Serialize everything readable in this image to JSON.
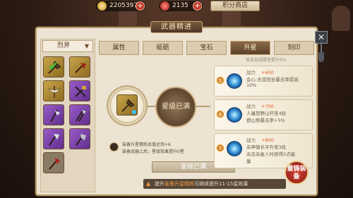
{
  "currency": {
    "gold": {
      "value": "2205397",
      "icon": "gold-ingot-icon"
    },
    "gems": {
      "value": "2135",
      "icon": "red-gem-icon"
    },
    "shop_label": "积分商店"
  },
  "panel": {
    "title": "武器精进",
    "filter_label": "烈斧",
    "tabs": [
      "属性",
      "砥砺",
      "宝石",
      "升星",
      "刻印"
    ],
    "active_tab": "升星"
  },
  "center": {
    "star_status": "星级已满",
    "desc_lines": [
      "装备升星精练总值达到+6",
      "装备武器上后，星级效果提升0星"
    ],
    "maxed_button": "星级已满"
  },
  "list": {
    "top_partial": "攻击加成属性提升5%",
    "items": [
      {
        "num": "5",
        "label": "战力",
        "value": "+600",
        "line1": "会心:无双回合暴击率提高",
        "line2": "10%",
        "line3": ""
      },
      {
        "num": "6",
        "label": "战力",
        "value": "+700",
        "line1": "人屠怒野山开至4段",
        "line2": "攒山势暴击率+5%",
        "line3": ""
      },
      {
        "num": "7",
        "label": "战力",
        "value": "+800",
        "line1": "杀神镇长平升至3段",
        "line2": "杀击杀敌人时获得2点能",
        "line3": "量"
      }
    ]
  },
  "forge_button": "重铸装备",
  "hint": {
    "prefix": "提升",
    "highlight": "装备升星精练",
    "suffix": "可继续提升11-15星效果"
  },
  "grid": {
    "slots": [
      {
        "rarity": "gold",
        "icon": "axe-weapon-icon",
        "selected": true
      },
      {
        "rarity": "gold",
        "icon": "winged-axe-icon",
        "selected": false
      },
      {
        "rarity": "gold",
        "icon": "butterfly-axe-icon",
        "selected": false
      },
      {
        "rarity": "purple",
        "icon": "crossed-axe-icon",
        "selected": false
      },
      {
        "rarity": "purple",
        "icon": "halberd-icon",
        "selected": false
      },
      {
        "rarity": "purple",
        "icon": "twin-axe-icon",
        "selected": false
      },
      {
        "rarity": "purple",
        "icon": "axe-pair-icon",
        "selected": false
      },
      {
        "rarity": "purple",
        "icon": "heavy-axe-icon",
        "selected": false
      },
      {
        "rarity": "dim",
        "icon": "red-axe-icon",
        "selected": false
      }
    ]
  }
}
